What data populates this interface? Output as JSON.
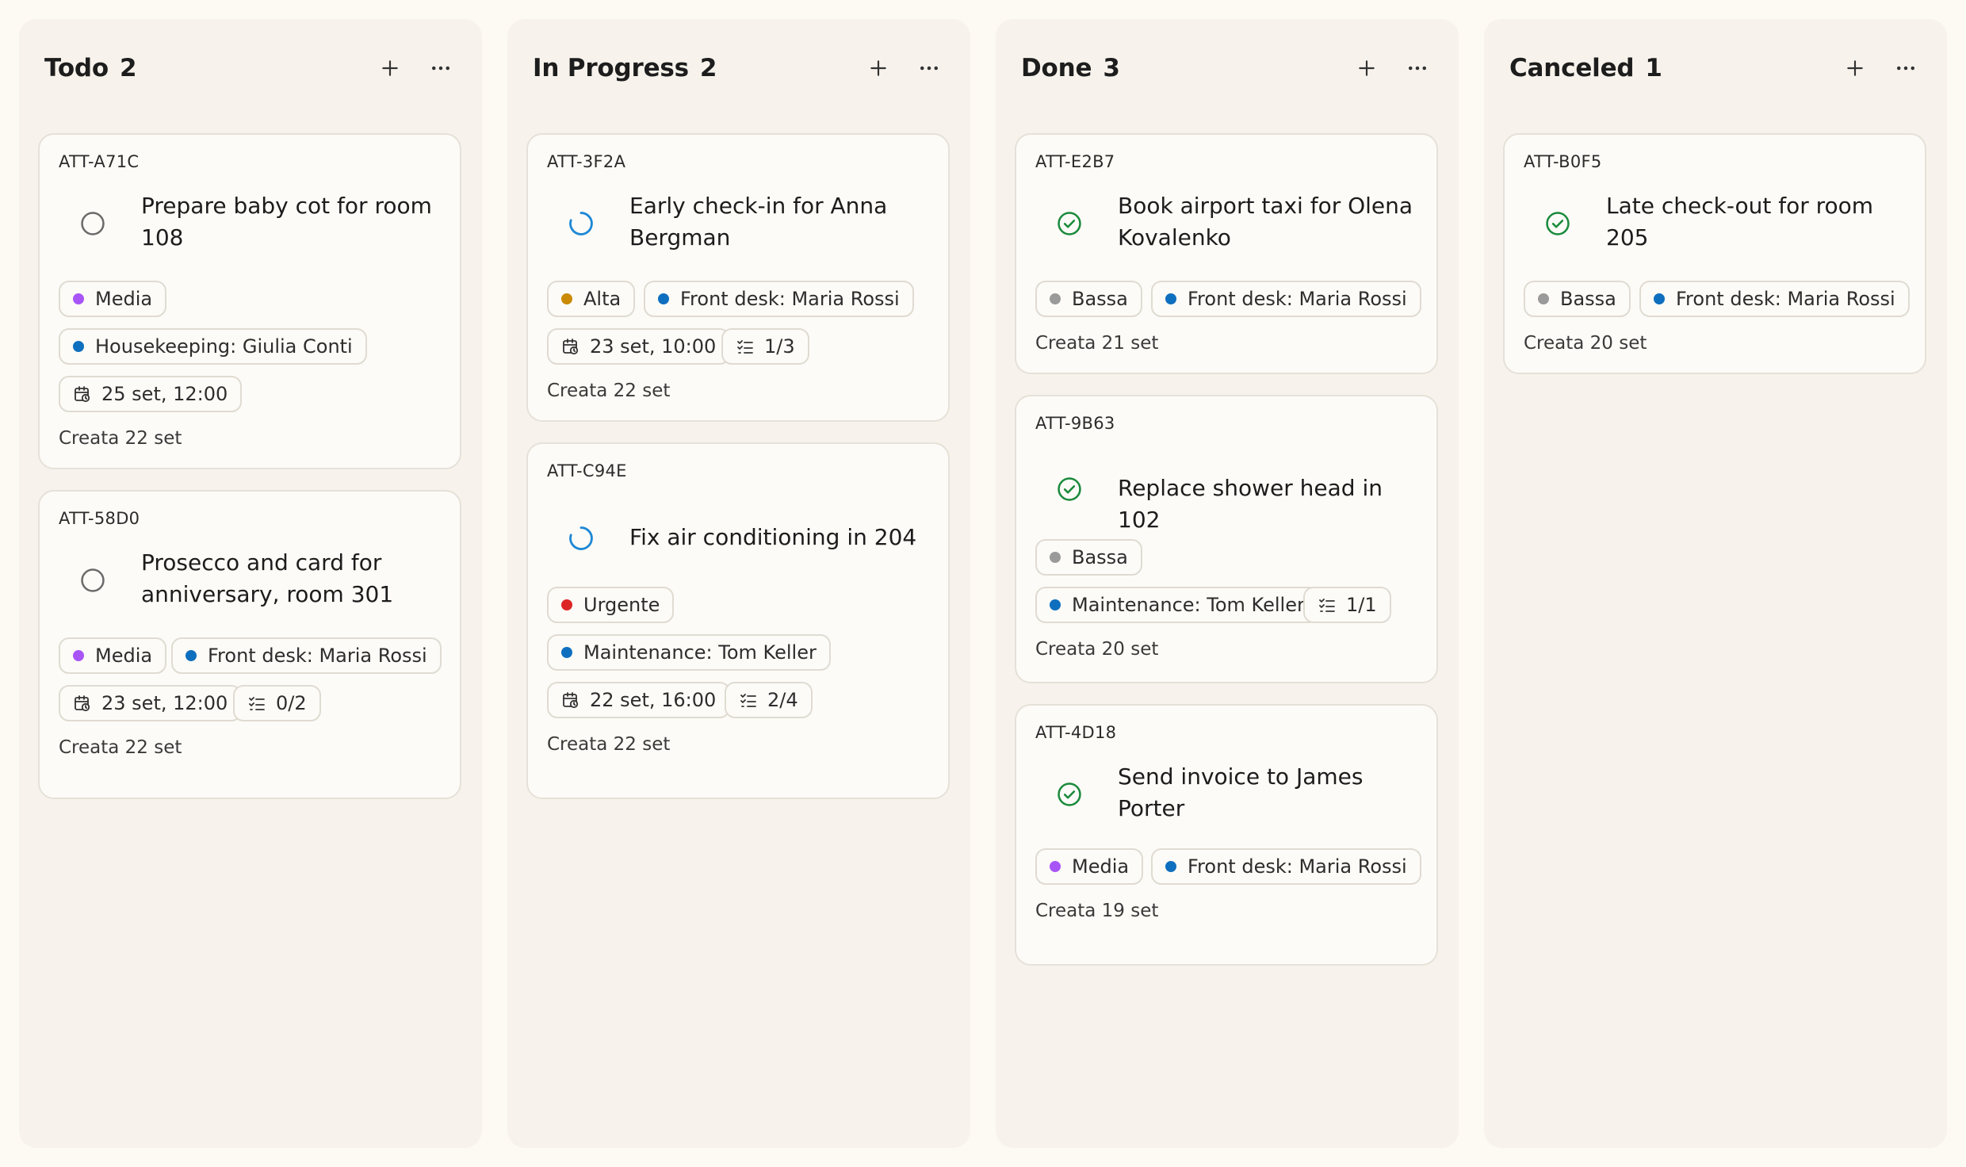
{
  "colors": {
    "media": "#a855f7",
    "alta": "#ca8a04",
    "urgente": "#dc2626",
    "bassa": "#9a9a9a",
    "assignee": "#0f6fbf",
    "todo_icon": "#6b6b6b",
    "progress_icon": "#1e88d6",
    "done_icon": "#1a8a3c"
  },
  "columns": [
    {
      "title": "Todo",
      "count": "2",
      "cards": [
        {
          "id": "ATT-A71C",
          "title": "Prepare baby cot for room 108",
          "status": "circle-icon",
          "priority": "Media",
          "assignee": "Housekeeping: Giulia Conti",
          "due": "25 set, 12:00",
          "created": "Creata 22 set"
        },
        {
          "id": "ATT-58D0",
          "title": "Prosecco and card for anniversary, room 301",
          "status": "circle-icon",
          "priority": "Media",
          "assignee": "Front desk: Maria Rossi",
          "due": "23 set, 12:00",
          "subtasks": "0/2",
          "created": "Creata 22 set"
        }
      ]
    },
    {
      "title": "In Progress",
      "count": "2",
      "cards": [
        {
          "id": "ATT-3F2A",
          "title": "Early check-in for Anna Bergman",
          "status": "progress-spinner-icon",
          "priority": "Alta",
          "assignee": "Front desk: Maria Rossi",
          "due": "23 set, 10:00",
          "subtasks": "1/3",
          "created": "Creata 22 set"
        },
        {
          "id": "ATT-C94E",
          "title": "Fix air conditioning in 204",
          "status": "progress-spinner-icon",
          "priority": "Urgente",
          "assignee": "Maintenance: Tom Keller",
          "due": "22 set, 16:00",
          "subtasks": "2/4",
          "created": "Creata 22 set"
        }
      ]
    },
    {
      "title": "Done",
      "count": "3",
      "cards": [
        {
          "id": "ATT-E2B7",
          "title": "Book airport taxi for Olena Kovalenko",
          "status": "check-circle-icon",
          "priority": "Bassa",
          "assignee": "Front desk: Maria Rossi",
          "created": "Creata 21 set"
        },
        {
          "id": "ATT-9B63",
          "title": "Replace shower head in 102",
          "status": "check-circle-icon",
          "priority": "Bassa",
          "assignee": "Maintenance: Tom Keller",
          "subtasks": "1/1",
          "created": "Creata 20 set"
        },
        {
          "id": "ATT-4D18",
          "title": "Send invoice to James Porter",
          "status": "check-circle-icon",
          "priority": "Media",
          "assignee": "Front desk: Maria Rossi",
          "created": "Creata 19 set"
        }
      ]
    },
    {
      "title": "Canceled",
      "count": "1",
      "cards": [
        {
          "id": "ATT-B0F5",
          "title": "Late check-out for room 205",
          "status": "check-circle-icon",
          "priority": "Bassa",
          "assignee": "Front desk: Maria Rossi",
          "created": "Creata 20 set"
        }
      ]
    }
  ]
}
